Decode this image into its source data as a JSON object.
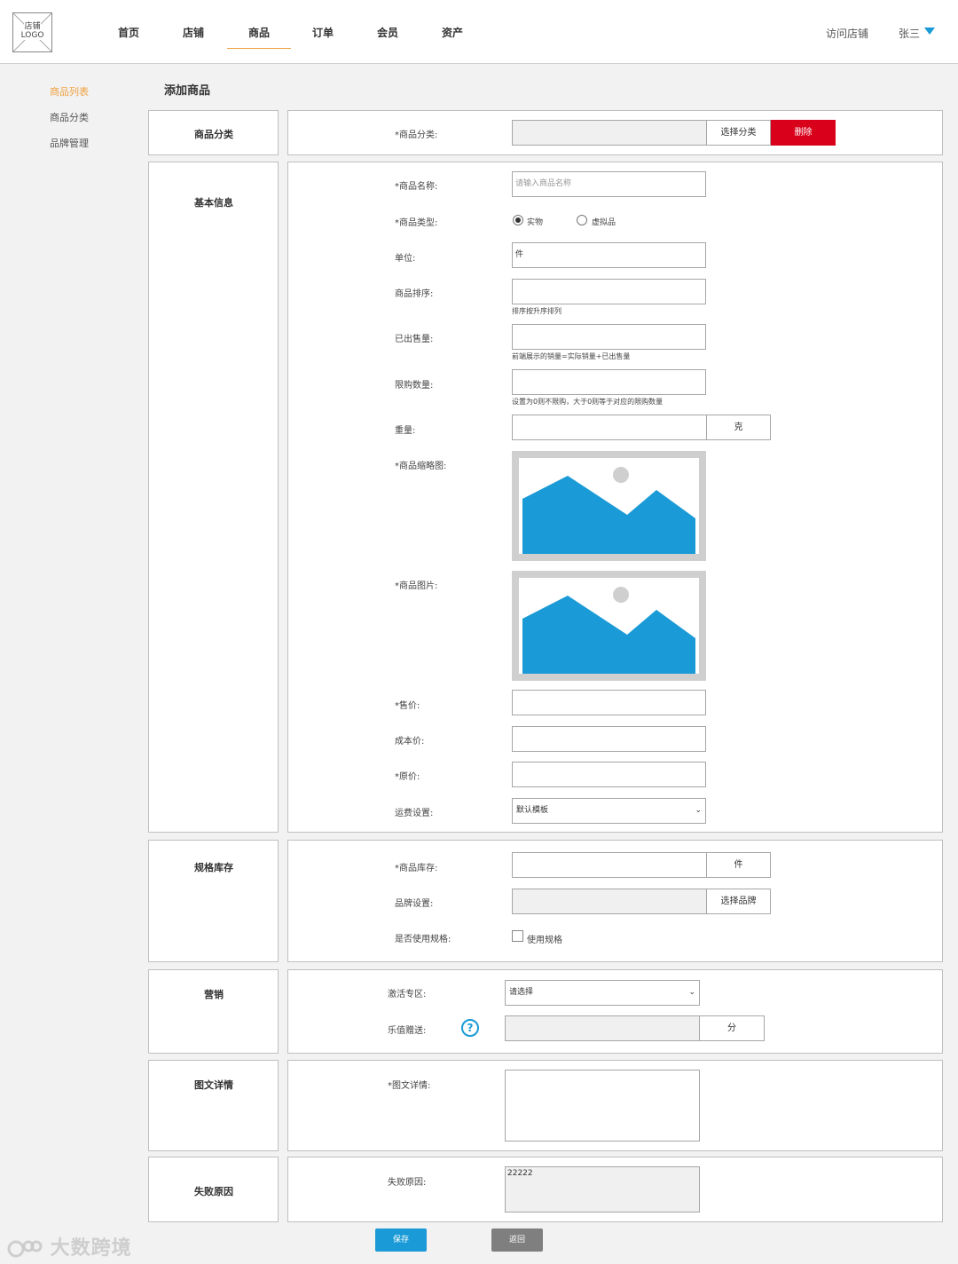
{
  "header": {
    "logo_line1": "店铺",
    "logo_line2": "LOGO",
    "nav": [
      "首页",
      "店铺",
      "商品",
      "订单",
      "会员",
      "资产"
    ],
    "active_nav": "商品",
    "visit_store": "访问店铺",
    "user_name": "张三"
  },
  "sidebar": {
    "items": [
      {
        "label": "商品列表",
        "active": true
      },
      {
        "label": "商品分类",
        "active": false
      },
      {
        "label": "品牌管理",
        "active": false
      }
    ]
  },
  "page_title": "添加商品",
  "category_section": {
    "title": "商品分类",
    "label": "*商品分类:",
    "value": "",
    "choose_button": "选择分类",
    "delete_button": "删除"
  },
  "basic_section": {
    "title": "基本信息",
    "name_label": "*商品名称:",
    "name_placeholder": "请输入商品名称",
    "type_label": "*商品类型:",
    "type_option_physical": "实物",
    "type_option_virtual": "虚拟品",
    "type_selected": "实物",
    "unit_label": "单位:",
    "unit_value": "件",
    "sort_label": "商品排序:",
    "sort_hint": "排序按升序排列",
    "sold_label": "已出售量:",
    "sold_hint": "前端展示的销量=实际销量+已出售量",
    "limit_label": "限购数量:",
    "limit_hint": "设置为0则不限购，大于0则等于对应的限购数量",
    "weight_label": "重量:",
    "weight_unit": "克",
    "thumb_label": "*商品缩略图:",
    "image_label": "*商品图片:",
    "price_label": "*售价:",
    "cost_label": "成本价:",
    "original_label": "*原价:",
    "shipping_label": "运费设置:",
    "shipping_value": "默认模板"
  },
  "spec_section": {
    "title": "规格库存",
    "stock_label": "*商品库存:",
    "stock_unit": "件",
    "brand_label": "品牌设置:",
    "brand_button": "选择品牌",
    "use_spec_label": "是否使用规格:",
    "use_spec_checkbox": "使用规格",
    "use_spec_checked": false
  },
  "marketing_section": {
    "title": "营销",
    "zone_label": "激活专区:",
    "zone_value": "请选择",
    "points_label": "乐值赠送:",
    "points_unit": "分"
  },
  "detail_section": {
    "title": "图文详情",
    "detail_label": "*图文详情:"
  },
  "fail_section": {
    "title": "失败原因",
    "fail_label": "失败原因:",
    "fail_value": "22222"
  },
  "footer": {
    "save_button": "保存",
    "back_button": "返回"
  },
  "watermark": "大数跨境",
  "colors": {
    "accent_orange": "#f0a040",
    "delete_red": "#d9001b",
    "save_blue": "#1a9ad6",
    "back_gray": "#7f7f7f",
    "image_blue": "#1a9ad6"
  }
}
